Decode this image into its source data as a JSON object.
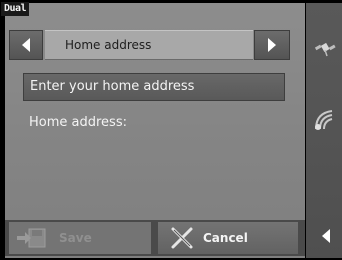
{
  "brand": {
    "logo_text": "Dual"
  },
  "header": {
    "title": "Home address",
    "prev_icon": "chevron-left-icon",
    "next_icon": "chevron-right-icon"
  },
  "input": {
    "placeholder": "Enter your home address",
    "value": ""
  },
  "field": {
    "label": "Home address:"
  },
  "footer": {
    "save_label": "Save",
    "save_enabled": false,
    "cancel_label": "Cancel"
  },
  "sidebar": {
    "icons": [
      "satellite-icon",
      "antenna-signal-icon",
      "back-arrow-icon"
    ]
  },
  "colors": {
    "panel": "#888888",
    "sidebar": "#555555",
    "title_bar": "#a8a8a8",
    "text_light": "#f4f4f4",
    "disabled_text": "#909090"
  }
}
